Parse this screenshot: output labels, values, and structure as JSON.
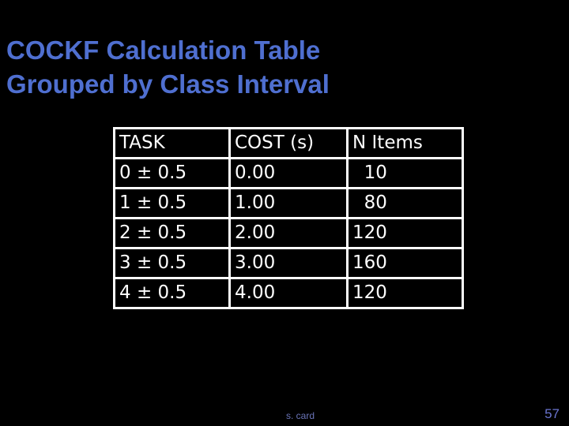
{
  "slide": {
    "title_line1": "COCKF Calculation Table",
    "title_line2": "Grouped by Class Interval",
    "author": "s. card",
    "page_number": "57"
  },
  "table": {
    "headers": [
      "TASK",
      "COST (s)",
      "N Items"
    ],
    "rows": [
      [
        "0 ± 0.5",
        "0.00",
        "  10"
      ],
      [
        "1 ± 0.5",
        "1.00",
        "  80"
      ],
      [
        "2 ± 0.5",
        "2.00",
        "120"
      ],
      [
        "3 ± 0.5",
        "3.00",
        "160"
      ],
      [
        "4 ± 0.5",
        "4.00",
        "120"
      ]
    ]
  },
  "colors": {
    "title": "#4f6fd0",
    "background": "#000000",
    "table_text": "#ffffff",
    "footer": "#6a74b8"
  }
}
